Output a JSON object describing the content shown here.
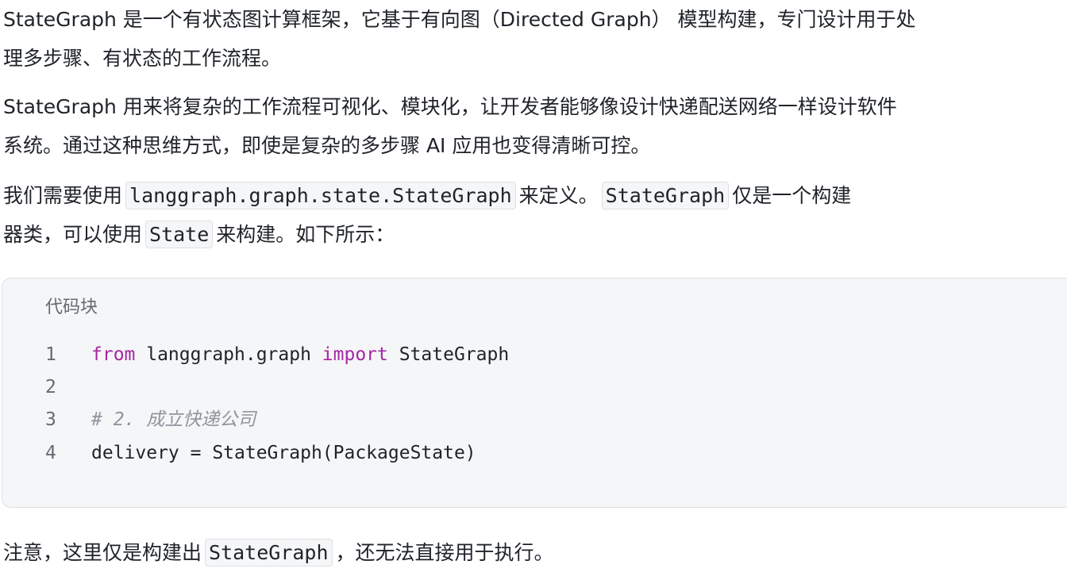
{
  "paragraphs": {
    "p1_line1": "StateGraph 是一个有状态图计算框架，它基于有向图（Directed Graph） 模型构建，专门设计用于处",
    "p1_line2": "理多步骤、有状态的工作流程。",
    "p2_line1": "StateGraph 用来将复杂的工作流程可视化、模块化，让开发者能够像设计快递配送网络一样设计软件",
    "p2_line2": "系统。通过这种思维方式，即使是复杂的多步骤 AI 应用也变得清晰可控。",
    "p3_line1_a": "我们需要使用",
    "p3_line1_code1": "langgraph.graph.state.StateGraph",
    "p3_line1_b": "来定义。",
    "p3_line1_code2": "StateGraph",
    "p3_line1_c": "仅是一个构建",
    "p3_line2_a": "器类，可以使用",
    "p3_line2_code": "State",
    "p3_line2_b": "来构建。如下所示：",
    "p4_a": "注意，这里仅是构建出",
    "p4_code": "StateGraph",
    "p4_b": "，还无法直接用于执行。"
  },
  "code_block": {
    "title": "代码块",
    "lines": [
      {
        "no": "1",
        "kw1": "from",
        "mid": " langgraph.graph ",
        "kw2": "import",
        "rest": " StateGraph"
      },
      {
        "no": "2",
        "text": ""
      },
      {
        "no": "3",
        "comment": "# 2. 成立快递公司"
      },
      {
        "no": "4",
        "text": "delivery = StateGraph(PackageState)"
      }
    ]
  },
  "colors": {
    "keyword": "#a626a4",
    "comment": "#8f959e",
    "code_bg": "#f5f6f7"
  }
}
